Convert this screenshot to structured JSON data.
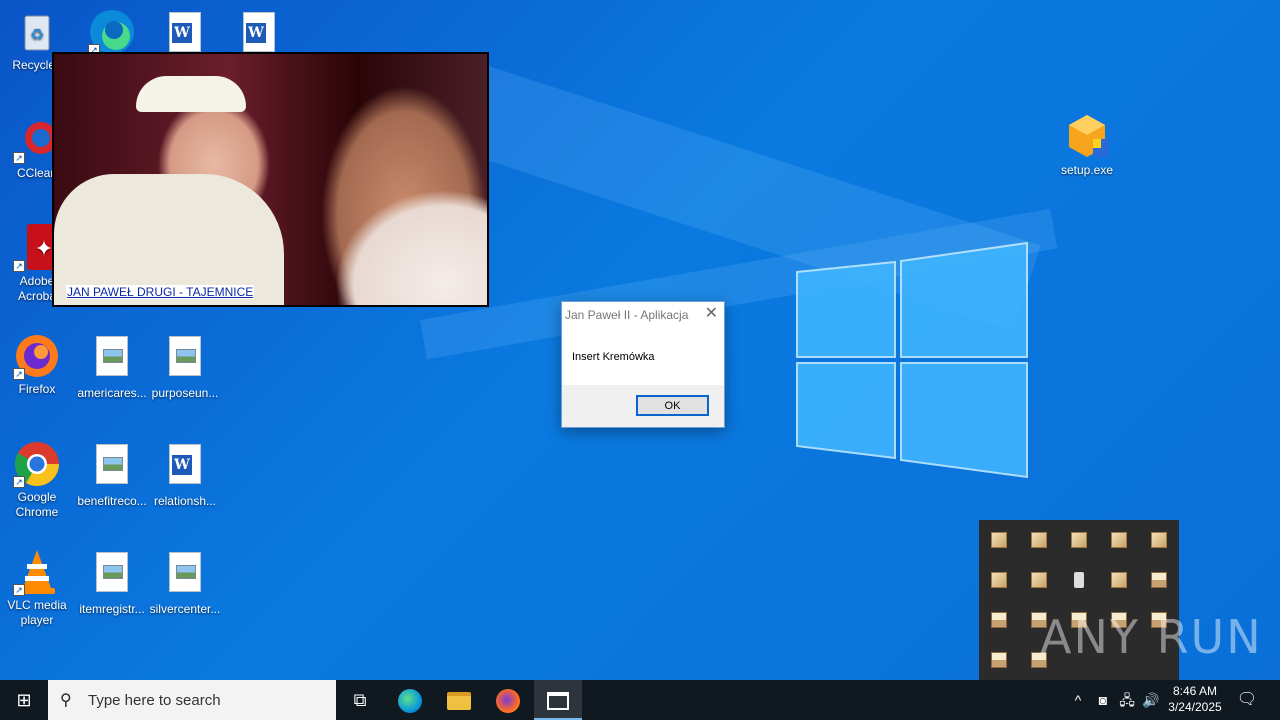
{
  "desktop": {
    "icons": [
      {
        "label": "Recycle Bin",
        "visible_label": "Recycle I",
        "icon": "recycle-bin-icon"
      },
      {
        "label": "CCleaner",
        "visible_label": "CClean",
        "icon": "ccleaner-icon"
      },
      {
        "label": "Adobe Acrobat",
        "visible_label": "Adobe Acroba",
        "icon": "acrobat-icon"
      },
      {
        "label": "Firefox",
        "icon": "firefox-icon"
      },
      {
        "label": "americares...",
        "icon": "image-file-icon"
      },
      {
        "label": "purposeun...",
        "icon": "image-file-icon"
      },
      {
        "label": "Google Chrome",
        "icon": "chrome-icon"
      },
      {
        "label": "benefitreco...",
        "icon": "image-file-icon"
      },
      {
        "label": "relationsh...",
        "icon": "word-doc-icon"
      },
      {
        "label": "VLC media player",
        "icon": "vlc-icon"
      },
      {
        "label": "itemregistr...",
        "icon": "image-file-icon"
      },
      {
        "label": "silvercenter...",
        "icon": "image-file-icon"
      },
      {
        "label": "setup.exe",
        "icon": "setup-exe-icon"
      }
    ]
  },
  "popup": {
    "link_text": "JAN PAWEŁ DRUGI - TAJEMNICE"
  },
  "dialog": {
    "title": "Jan Paweł II - Aplikacja",
    "message": "Insert Kremówka",
    "ok_label": "OK"
  },
  "watermark": "ANY RUN",
  "taskbar": {
    "search_placeholder": "Type here to search",
    "time": "8:46 AM",
    "date": "3/24/2025"
  }
}
